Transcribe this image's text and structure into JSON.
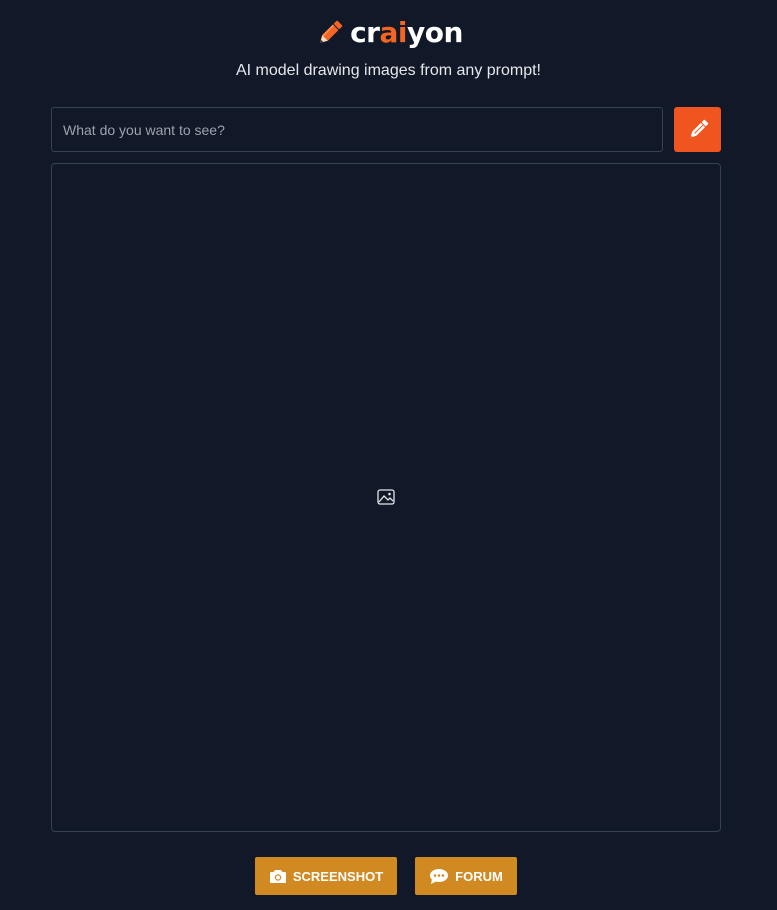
{
  "brand": {
    "name_prefix": "cr",
    "name_accent": "ai",
    "name_suffix": "yon",
    "logo_icon": "pencil-icon",
    "accent_color": "#f26522"
  },
  "tagline": "AI model drawing images from any prompt!",
  "search": {
    "placeholder": "What do you want to see?",
    "value": ""
  },
  "draw_button": {
    "icon": "pencil-icon",
    "color": "#f0551f"
  },
  "image_area": {
    "placeholder_icon": "image-icon"
  },
  "footer": {
    "screenshot_label": "SCREENSHOT",
    "screenshot_icon": "camera-icon",
    "forum_label": "FORUM",
    "forum_icon": "chat-bubble-icon",
    "button_color": "#d18a22"
  },
  "colors": {
    "background": "#111827",
    "border": "#374151"
  }
}
